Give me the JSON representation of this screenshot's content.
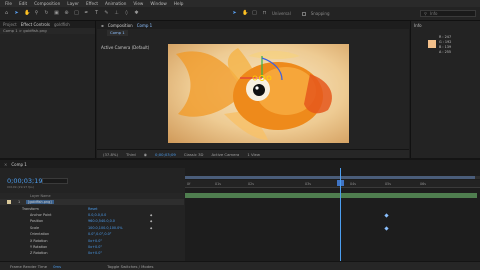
{
  "menubar": {
    "items": [
      "File",
      "Edit",
      "Composition",
      "Layer",
      "Effect",
      "Animation",
      "View",
      "Window",
      "Help"
    ]
  },
  "toolbar": {
    "tools": [
      "home-icon",
      "selection-tool-icon",
      "hand-tool-icon",
      "zoom-tool-icon",
      "rotate-tool-icon",
      "camera-tool-icon",
      "pan-behind-tool-icon",
      "rectangle-tool-icon",
      "pen-tool-icon",
      "type-tool-icon",
      "brush-tool-icon",
      "clone-stamp-tool-icon",
      "eraser-tool-icon",
      "puppet-tool-icon"
    ],
    "universal_label": "Universal",
    "snapping_label": "Snapping",
    "search_label": "Info"
  },
  "left_panel": {
    "tabs": [
      "Project",
      "Effect Controls",
      "goldfish"
    ],
    "sub_tab": "Comp 1 > goldfish.png"
  },
  "composition": {
    "tab": "Composition",
    "comp_name": "Comp 1",
    "sub_tab": "Comp 1",
    "view_label": "Active Camera (Default)",
    "zoom": "(37.8%)",
    "resolution": "Third",
    "timecode": "0;00;03;09",
    "view_mode": "Classic 3D",
    "camera": "Active Camera",
    "views": "1 View"
  },
  "info_panel": {
    "title": "Info",
    "r": "R : 247",
    "g": "G : 192",
    "b": "B : 139",
    "a": "A : 255",
    "swatch_color": "#f3c08b"
  },
  "timeline": {
    "tab": "Comp 1",
    "timecode": "0;00;03;19",
    "frames": "00109 (29.97 fps)",
    "column_header": "Layer Name",
    "rulers": [
      "0f",
      "01s",
      "02s",
      "03s",
      "04s",
      "05s",
      "06s"
    ],
    "layer_number": "1",
    "layer_name": "[goldfish.png]",
    "properties": [
      {
        "name": "Transform",
        "value": "Reset",
        "keyframe": ""
      },
      {
        "name": "Anchor Point",
        "value": "0.0,0.0,0.0",
        "keyframe": "◆"
      },
      {
        "name": "Position",
        "value": "960.0,540.0,0.0",
        "keyframe": "◆"
      },
      {
        "name": "Scale",
        "value": "100.0,100.0,100.0%",
        "keyframe": "◆"
      },
      {
        "name": "Orientation",
        "value": "0.0°,0.0°,0.0°",
        "keyframe": ""
      },
      {
        "name": "X Rotation",
        "value": "0x+0.0°",
        "keyframe": ""
      },
      {
        "name": "Y Rotation",
        "value": "0x+0.0°",
        "keyframe": ""
      },
      {
        "name": "Z Rotation",
        "value": "0x+0.0°",
        "keyframe": ""
      }
    ],
    "footer_frame_render": "Frame Render Time",
    "footer_time": "0ms",
    "footer_toggle": "Toggle Switches / Modes"
  },
  "colors": {
    "accent": "#4c9ef0",
    "layer_bar": "#4f7e4f",
    "panel_bg": "#232323"
  }
}
